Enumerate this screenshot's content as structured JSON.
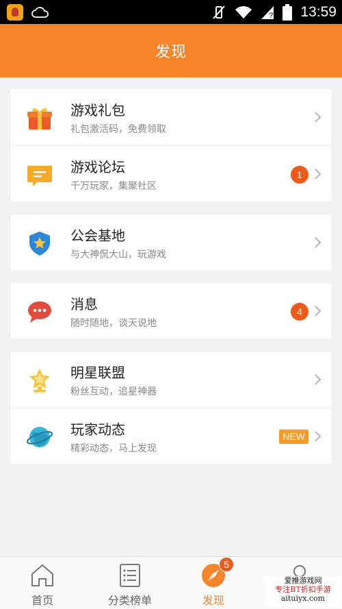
{
  "status_bar": {
    "time": "13:59"
  },
  "header": {
    "title": "发现"
  },
  "cards": [
    {
      "rows": [
        {
          "title": "游戏礼包",
          "subtitle": "礼包激活码，免费领取",
          "icon": "gift-icon"
        },
        {
          "title": "游戏论坛",
          "subtitle": "千万玩家，集聚社区",
          "icon": "forum-icon",
          "badge": "1"
        }
      ]
    },
    {
      "rows": [
        {
          "title": "公会基地",
          "subtitle": "与大神侃大山，玩游戏",
          "icon": "guild-shield-icon"
        }
      ]
    },
    {
      "rows": [
        {
          "title": "消息",
          "subtitle": "随时随地，谈天说地",
          "icon": "chat-bubble-icon",
          "badge": "4"
        }
      ]
    },
    {
      "rows": [
        {
          "title": "明星联盟",
          "subtitle": "粉丝互动，追星神器",
          "icon": "star-trophy-icon"
        },
        {
          "title": "玩家动态",
          "subtitle": "精彩动态，马上发现",
          "icon": "planet-icon",
          "tag": "NEW"
        }
      ]
    }
  ],
  "tabs": [
    {
      "label": "首页",
      "icon": "home-icon"
    },
    {
      "label": "分类榜单",
      "icon": "list-icon"
    },
    {
      "label": "发现",
      "icon": "compass-icon",
      "badge": "5",
      "active": true
    },
    {
      "label": "",
      "icon": "profile-icon"
    }
  ],
  "watermark": {
    "line1": "爱推游戏网",
    "line2": "专注BT折扣手游",
    "line3": "aituiyx.com"
  },
  "colors": {
    "accent": "#f7842a",
    "badge": "#ef5a1c",
    "new_tag": "#f79a27"
  }
}
